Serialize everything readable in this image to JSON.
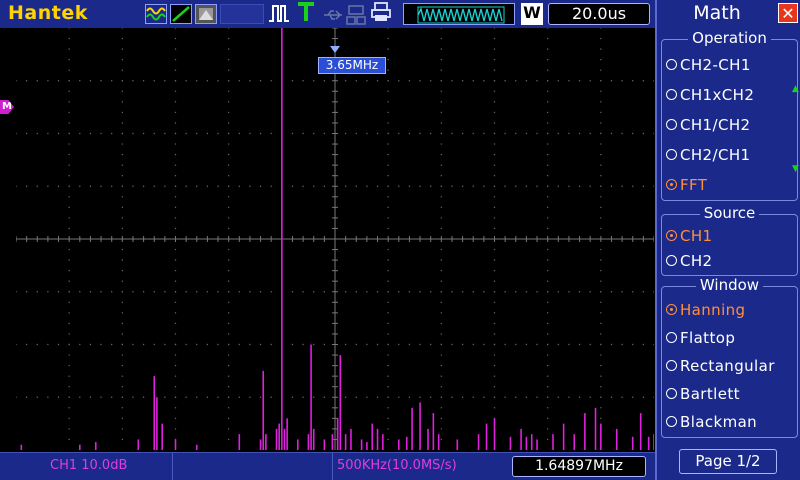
{
  "header": {
    "brand": "Hantek",
    "timebase": "20.0us",
    "w_label": "W"
  },
  "display": {
    "marker_label": "3.65MHz",
    "math_marker": "M"
  },
  "footer": {
    "ch1_scale": "CH1 10.0dB",
    "fft_span": "500KHz(10.0MS/s)",
    "frequency": "1.64897MHz"
  },
  "menu": {
    "title": "Math",
    "operation": {
      "title": "Operation",
      "options": [
        "CH2-CH1",
        "CH1xCH2",
        "CH1/CH2",
        "CH2/CH1",
        "FFT"
      ]
    },
    "source": {
      "title": "Source",
      "options": [
        "CH1",
        "CH2"
      ]
    },
    "window": {
      "title": "Window",
      "options": [
        "Hanning",
        "Flattop",
        "Rectangular",
        "Bartlett",
        "Blackman"
      ]
    },
    "page": "Page 1/2"
  },
  "colors": {
    "trace": "#e020e0",
    "selected": "#ff8f3a",
    "panel": "#1b2a8a",
    "brand": "#ffd400"
  },
  "chart_data": {
    "type": "bar",
    "description_units": "FFT spectrum, screen divisions (0 = top, 8 = bottom)",
    "x": [
      0.1,
      1.2,
      1.5,
      2.3,
      2.6,
      2.65,
      2.75,
      3.0,
      3.4,
      4.2,
      4.6,
      4.65,
      4.7,
      4.9,
      4.95,
      5.0,
      5.05,
      5.1,
      5.3,
      5.5,
      5.55,
      5.6,
      5.8,
      5.95,
      6.05,
      6.1,
      6.2,
      6.3,
      6.5,
      6.6,
      6.7,
      6.8,
      6.9,
      7.2,
      7.35,
      7.45,
      7.6,
      7.75,
      7.85,
      7.95,
      8.3,
      8.7,
      8.85,
      9.0,
      9.3,
      9.5,
      9.6,
      9.7,
      9.8,
      10.1,
      10.3,
      10.5,
      10.7,
      10.9,
      11.0,
      11.3,
      11.6,
      11.75,
      11.9,
      12.0
    ],
    "y": [
      7.9,
      7.9,
      7.85,
      7.8,
      6.6,
      7.0,
      7.5,
      7.8,
      7.9,
      7.7,
      7.8,
      6.5,
      7.7,
      7.6,
      7.5,
      0.0,
      7.6,
      7.4,
      7.8,
      7.7,
      6.0,
      7.6,
      7.8,
      7.7,
      7.4,
      6.2,
      7.7,
      7.6,
      7.8,
      7.85,
      7.5,
      7.6,
      7.7,
      7.8,
      7.75,
      7.2,
      7.1,
      7.6,
      7.3,
      7.7,
      7.8,
      7.7,
      7.5,
      7.4,
      7.75,
      7.6,
      7.75,
      7.7,
      7.8,
      7.7,
      7.5,
      7.7,
      7.3,
      7.2,
      7.5,
      7.6,
      7.75,
      7.3,
      7.75,
      7.7
    ],
    "xlim": [
      0,
      12
    ],
    "ylim": [
      0,
      8
    ],
    "grid": true
  }
}
